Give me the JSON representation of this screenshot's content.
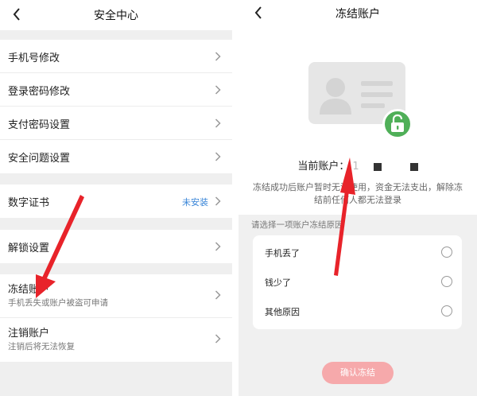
{
  "left": {
    "title": "安全中心",
    "groups": [
      {
        "items": [
          {
            "label": "手机号修改"
          },
          {
            "label": "登录密码修改"
          },
          {
            "label": "支付密码设置"
          },
          {
            "label": "安全问题设置"
          }
        ]
      },
      {
        "items": [
          {
            "label": "数字证书",
            "status": "未安装"
          }
        ]
      },
      {
        "items": [
          {
            "label": "解锁设置"
          }
        ]
      },
      {
        "items": [
          {
            "label": "冻结账户",
            "sub": "手机丢失或账户被盗可申请"
          },
          {
            "label": "注销账户",
            "sub": "注销后将无法恢复"
          }
        ]
      }
    ]
  },
  "right": {
    "title": "冻结账户",
    "account_label": "当前账户：",
    "account_value": "1",
    "notice": "冻结成功后账户暂时无法使用，资金无法支出，解除冻结前任何人都无法登录",
    "reason_prompt": "请选择一项账户冻结原因",
    "reasons": [
      "手机丢了",
      "钱少了",
      "其他原因"
    ],
    "confirm_label": "确认冻结"
  },
  "colors": {
    "accent_link": "#3a86d8",
    "lock_green": "#4faf58",
    "confirm_pink": "#f6a9ab",
    "arrow_red": "#e8232a"
  }
}
